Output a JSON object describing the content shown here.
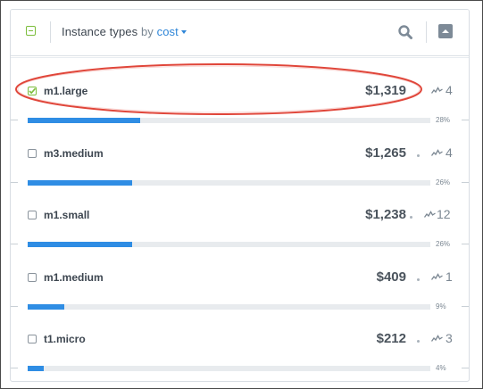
{
  "header": {
    "title": "Instance types",
    "by_label": "by",
    "sort_label": "cost",
    "select_all_state": "partial",
    "search_icon": "search-icon",
    "collapse_icon": "chevron-up-icon"
  },
  "rows": [
    {
      "name": "m1.large",
      "cost": "$1,319",
      "count": "4",
      "percent_label": "28%",
      "fill_fraction": 0.28,
      "checked": true
    },
    {
      "name": "m3.medium",
      "cost": "$1,265",
      "count": "4",
      "percent_label": "26%",
      "fill_fraction": 0.26,
      "checked": false
    },
    {
      "name": "m1.small",
      "cost": "$1,238",
      "count": "12",
      "percent_label": "26%",
      "fill_fraction": 0.26,
      "checked": false
    },
    {
      "name": "m1.medium",
      "cost": "$409",
      "count": "1",
      "percent_label": "9%",
      "fill_fraction": 0.09,
      "checked": false
    },
    {
      "name": "t1.micro",
      "cost": "$212",
      "count": "3",
      "percent_label": "4%",
      "fill_fraction": 0.04,
      "checked": false
    }
  ],
  "colors": {
    "bar": "#2f8de4",
    "accent_green": "#7cbd3c",
    "link_blue": "#2f86d8",
    "highlight_red": "#e0463a"
  }
}
